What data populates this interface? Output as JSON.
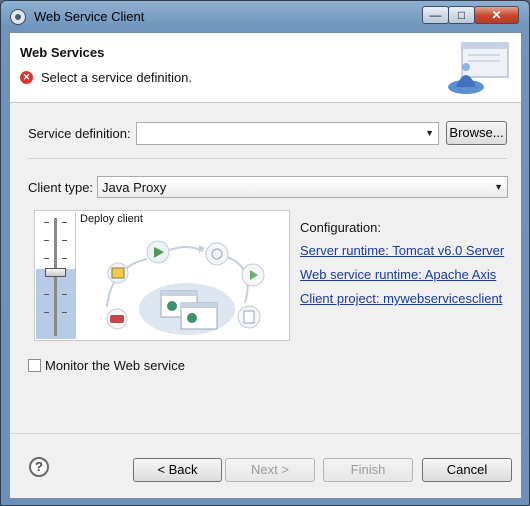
{
  "window": {
    "title": "Web Service Client",
    "min_glyph": "—",
    "max_glyph": "□",
    "close_glyph": "✕"
  },
  "banner": {
    "title": "Web Services",
    "message": "Select a service definition.",
    "error_glyph": "✕"
  },
  "service_definition": {
    "label": "Service definition:",
    "value": "",
    "browse_label": "Browse..."
  },
  "client_type": {
    "label": "Client type:",
    "value": "Java Proxy"
  },
  "preview": {
    "slider_label": "Deploy client"
  },
  "configuration": {
    "title": "Configuration:",
    "server_runtime": "Server runtime: Tomcat v6.0 Server",
    "ws_runtime": "Web service runtime: Apache Axis",
    "client_project": "Client project: mywebservicesclient"
  },
  "monitor": {
    "label": "Monitor the Web service",
    "checked": false
  },
  "buttons": {
    "back": "< Back",
    "next": "Next >",
    "finish": "Finish",
    "cancel": "Cancel",
    "help": "?"
  }
}
